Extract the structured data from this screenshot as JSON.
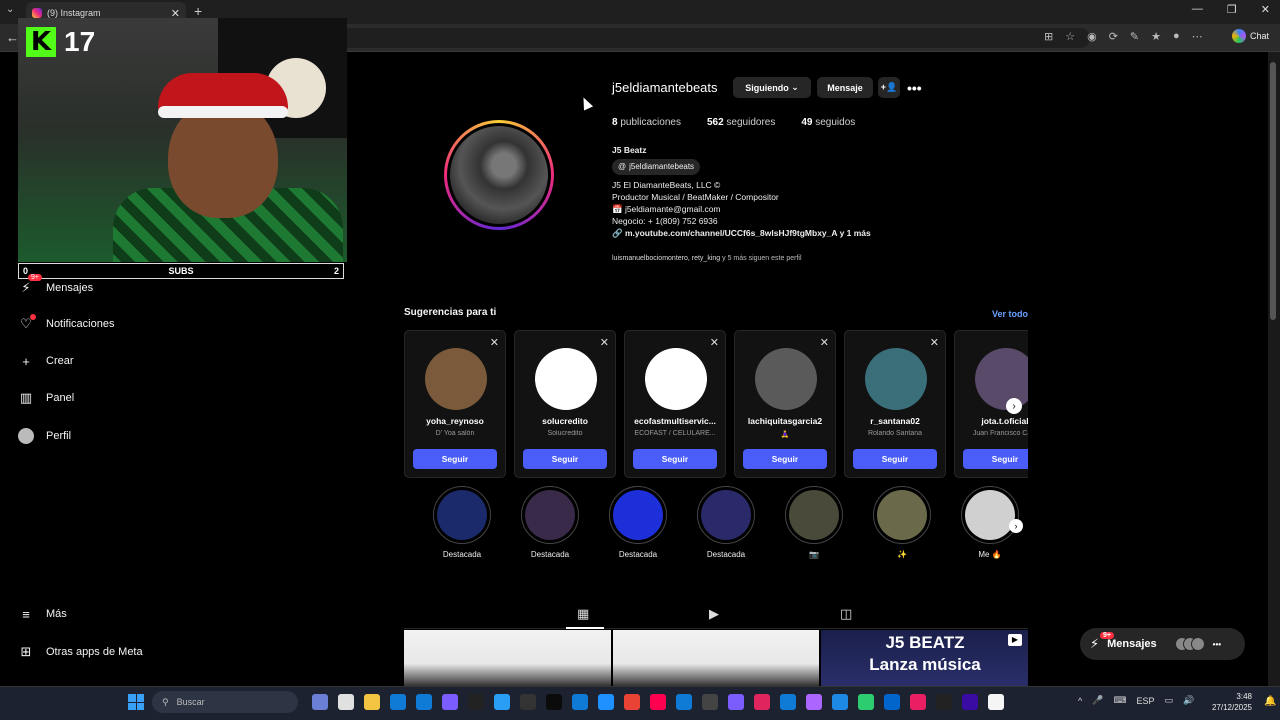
{
  "browser": {
    "tab_title": "(9) Instagram",
    "tab_close": "✕",
    "new_tab": "+",
    "back": "←",
    "chat_label": "Chat",
    "window_controls": [
      "—",
      "❐",
      "✕"
    ]
  },
  "stream_overlay": {
    "kick_count": "17",
    "subs_left": "0",
    "subs_label": "SUBS",
    "subs_right": "2"
  },
  "sidebar": {
    "items": [
      {
        "label": "Mensajes",
        "icon": "messenger-icon",
        "glyph": "⚡",
        "badge": "9+"
      },
      {
        "label": "Notificaciones",
        "icon": "heart-icon",
        "glyph": "♡"
      },
      {
        "label": "Crear",
        "icon": "plus-icon",
        "glyph": "+"
      },
      {
        "label": "Panel",
        "icon": "chart-icon",
        "glyph": "▥"
      },
      {
        "label": "Perfil",
        "icon": "avatar-icon",
        "glyph": "●"
      },
      {
        "label": "Más",
        "icon": "menu-icon",
        "glyph": "≡"
      },
      {
        "label": "Otras apps de Meta",
        "icon": "meta-apps-icon",
        "glyph": "⊞"
      }
    ]
  },
  "profile": {
    "username": "j5eldiamantebeats",
    "following_btn": "Siguiendo",
    "message_btn": "Mensaje",
    "add_user_icon": "add-user-icon",
    "more_icon": "more-icon",
    "stats": {
      "posts_count": "8",
      "posts_label": "publicaciones",
      "followers_count": "562",
      "followers_label": "seguidores",
      "following_count": "49",
      "following_label": "seguidos"
    },
    "display_name": "J5 Beatz",
    "threads_handle": "j5eldiamantebeats",
    "bio_lines": [
      "J5 El DiamanteBeats, LLC ©",
      "Productor Musical / BeatMaker / Compositor",
      "📅 j5eldiamante@gmail.com",
      "Negocio: + 1(809) 752 6936"
    ],
    "link": "m.youtube.com/channel/UCCf6s_8wlsHJf9tgMbxy_A y 1 más",
    "followed_by_names": "luismanuelbociomontero, rety_king",
    "followed_by_rest": "y 5 más siguen este perfil"
  },
  "suggestions": {
    "title": "Sugerencias para ti",
    "see_all": "Ver todo",
    "follow_label": "Seguir",
    "cards": [
      {
        "username": "yoha_reynoso",
        "subtitle": "D' Yoa salón",
        "color": "#7a5a3a"
      },
      {
        "username": "solucredito",
        "subtitle": "Solucredito",
        "color": "#ffffff"
      },
      {
        "username": "ecofastmultiservic...",
        "subtitle": "ECOFAST / CELULARE...",
        "color": "#ffffff"
      },
      {
        "username": "lachiquitasgarcia2",
        "subtitle": "🧘‍♀️",
        "color": "#5a5a5a"
      },
      {
        "username": "r_santana02",
        "subtitle": "Rolando Santana",
        "color": "#3a6f7a"
      },
      {
        "username": "jota.t.oficial",
        "subtitle": "Juan Francisco Ca...",
        "color": "#5a4a6a"
      }
    ]
  },
  "highlights": [
    {
      "label": "Destacada",
      "color": "#1a2a6a"
    },
    {
      "label": "Destacada",
      "color": "#3a2a4a"
    },
    {
      "label": "Destacada",
      "color": "#1d2fd8"
    },
    {
      "label": "Destacada",
      "color": "#2a2a6a"
    },
    {
      "label": "📷",
      "color": "#4a4a3a"
    },
    {
      "label": "✨",
      "color": "#6a6a4a"
    },
    {
      "label": "Me 🔥",
      "color": "#d0d0d0"
    }
  ],
  "tabs": {
    "posts_icon": "grid-icon",
    "reels_icon": "reels-icon",
    "tagged_icon": "tagged-icon"
  },
  "posts": {
    "post3_line1": "J5 BEATZ",
    "post3_line2": "Lanza música"
  },
  "messages_pill": {
    "label": "Mensajes",
    "badge": "9+"
  },
  "taskbar": {
    "search_placeholder": "Buscar",
    "language": "ESP",
    "time": "3:48",
    "date": "27/12/2025"
  }
}
